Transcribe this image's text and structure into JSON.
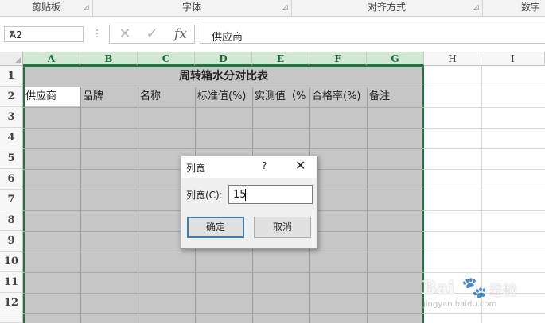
{
  "ribbon": {
    "groups": [
      "剪贴板",
      "字体",
      "对齐方式",
      "数字"
    ]
  },
  "formula_bar": {
    "name_box": "A2",
    "cancel_icon": "✕",
    "enter_icon": "✓",
    "fx_label": "fx",
    "value": "供应商"
  },
  "sheet": {
    "columns": [
      "A",
      "B",
      "C",
      "D",
      "E",
      "F",
      "G",
      "H",
      "I"
    ],
    "rows": [
      "1",
      "2",
      "3",
      "4",
      "5",
      "6",
      "7",
      "8",
      "9",
      "10",
      "11",
      "12"
    ],
    "title": "周转箱水分对比表",
    "headers": [
      "供应商",
      "品牌",
      "名称",
      "标准值(%)",
      "实测值（%",
      "合格率(%)",
      "备注"
    ]
  },
  "dialog": {
    "title": "列宽",
    "help": "?",
    "close": "✕",
    "label": "列宽(C):",
    "value": "15",
    "ok": "确定",
    "cancel": "取消"
  },
  "watermark": {
    "brand": "Bai",
    "brand2": "经验",
    "url": "jingyan.baidu.com"
  }
}
